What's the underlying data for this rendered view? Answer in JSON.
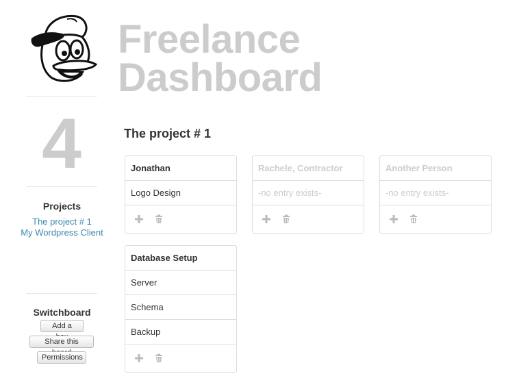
{
  "header": {
    "title_line1": "Freelance",
    "title_line2": "Dashboard"
  },
  "sidebar": {
    "project_count": "4",
    "projects_heading": "Projects",
    "projects": [
      {
        "label": "The project # 1"
      },
      {
        "label": "My Wordpress Client"
      }
    ],
    "switchboard_heading": "Switchboard",
    "buttons": {
      "add_box": "Add a box",
      "share_board": "Share this board",
      "permissions": "Permissions"
    }
  },
  "board": {
    "title": "The project # 1",
    "boxes": [
      {
        "name": "Jonathan",
        "items": [
          "Logo Design"
        ]
      },
      {
        "name": "Rachele, Contractor",
        "items": [
          "-no entry exists-"
        ]
      },
      {
        "name": "Another Person",
        "items": [
          "-no entry exists-"
        ]
      },
      {
        "name": "Database Setup",
        "items": [
          "Server",
          "Schema",
          "Backup"
        ]
      }
    ]
  },
  "colors": {
    "link": "#3a87ad",
    "muted": "#cccccc",
    "border": "#dddddd",
    "text": "#333333"
  },
  "icons": [
    "duck-avatar-icon",
    "plus-icon",
    "trash-icon"
  ]
}
